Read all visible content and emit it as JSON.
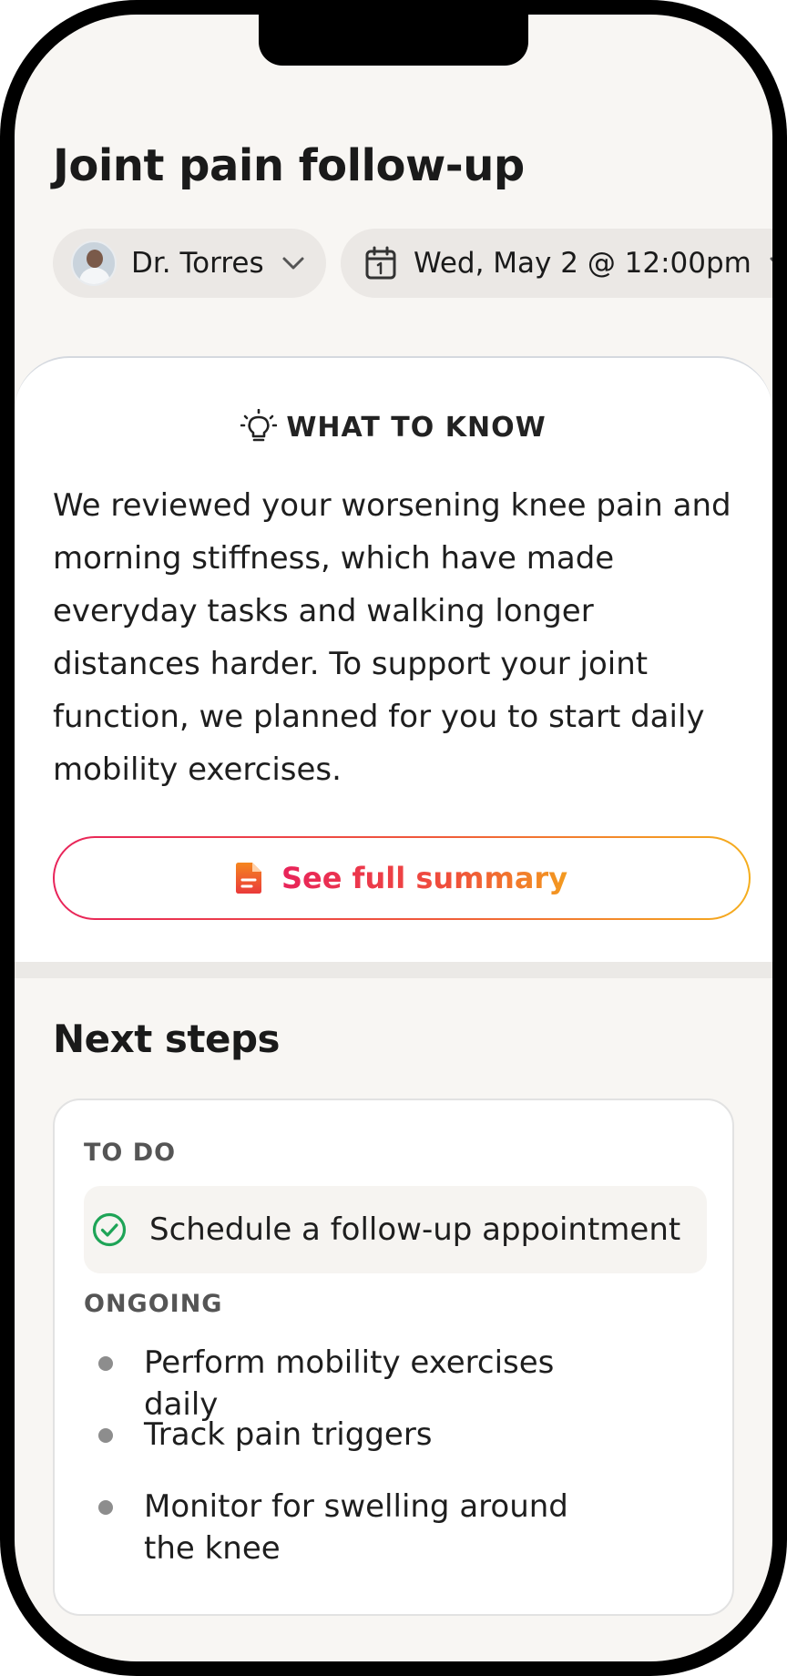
{
  "header": {
    "title": "Joint pain follow-up"
  },
  "chips": {
    "doctor": "Dr. Torres",
    "datetime": "Wed, May 2 @ 12:00pm"
  },
  "what_to_know": {
    "heading": "WHAT TO KNOW",
    "body": "We reviewed your worsening knee pain and morning stiffness, which have made everyday tasks and walking longer distances harder. To support your joint function, we planned for you to start daily mobility exercises.",
    "button_label": "See full summary"
  },
  "next_steps": {
    "title": "Next steps",
    "todo_label": "TO DO",
    "todo_items": [
      "Schedule a follow-up appointment"
    ],
    "ongoing_label": "ONGOING",
    "ongoing_items": [
      "Perform mobility exercises daily",
      "Track pain triggers",
      "Monitor for swelling around the knee"
    ]
  },
  "colors": {
    "background": "#f8f6f3",
    "accent_gradient_start": "#e8235a",
    "accent_gradient_end": "#f5ae1d",
    "check_green": "#1ea457"
  }
}
